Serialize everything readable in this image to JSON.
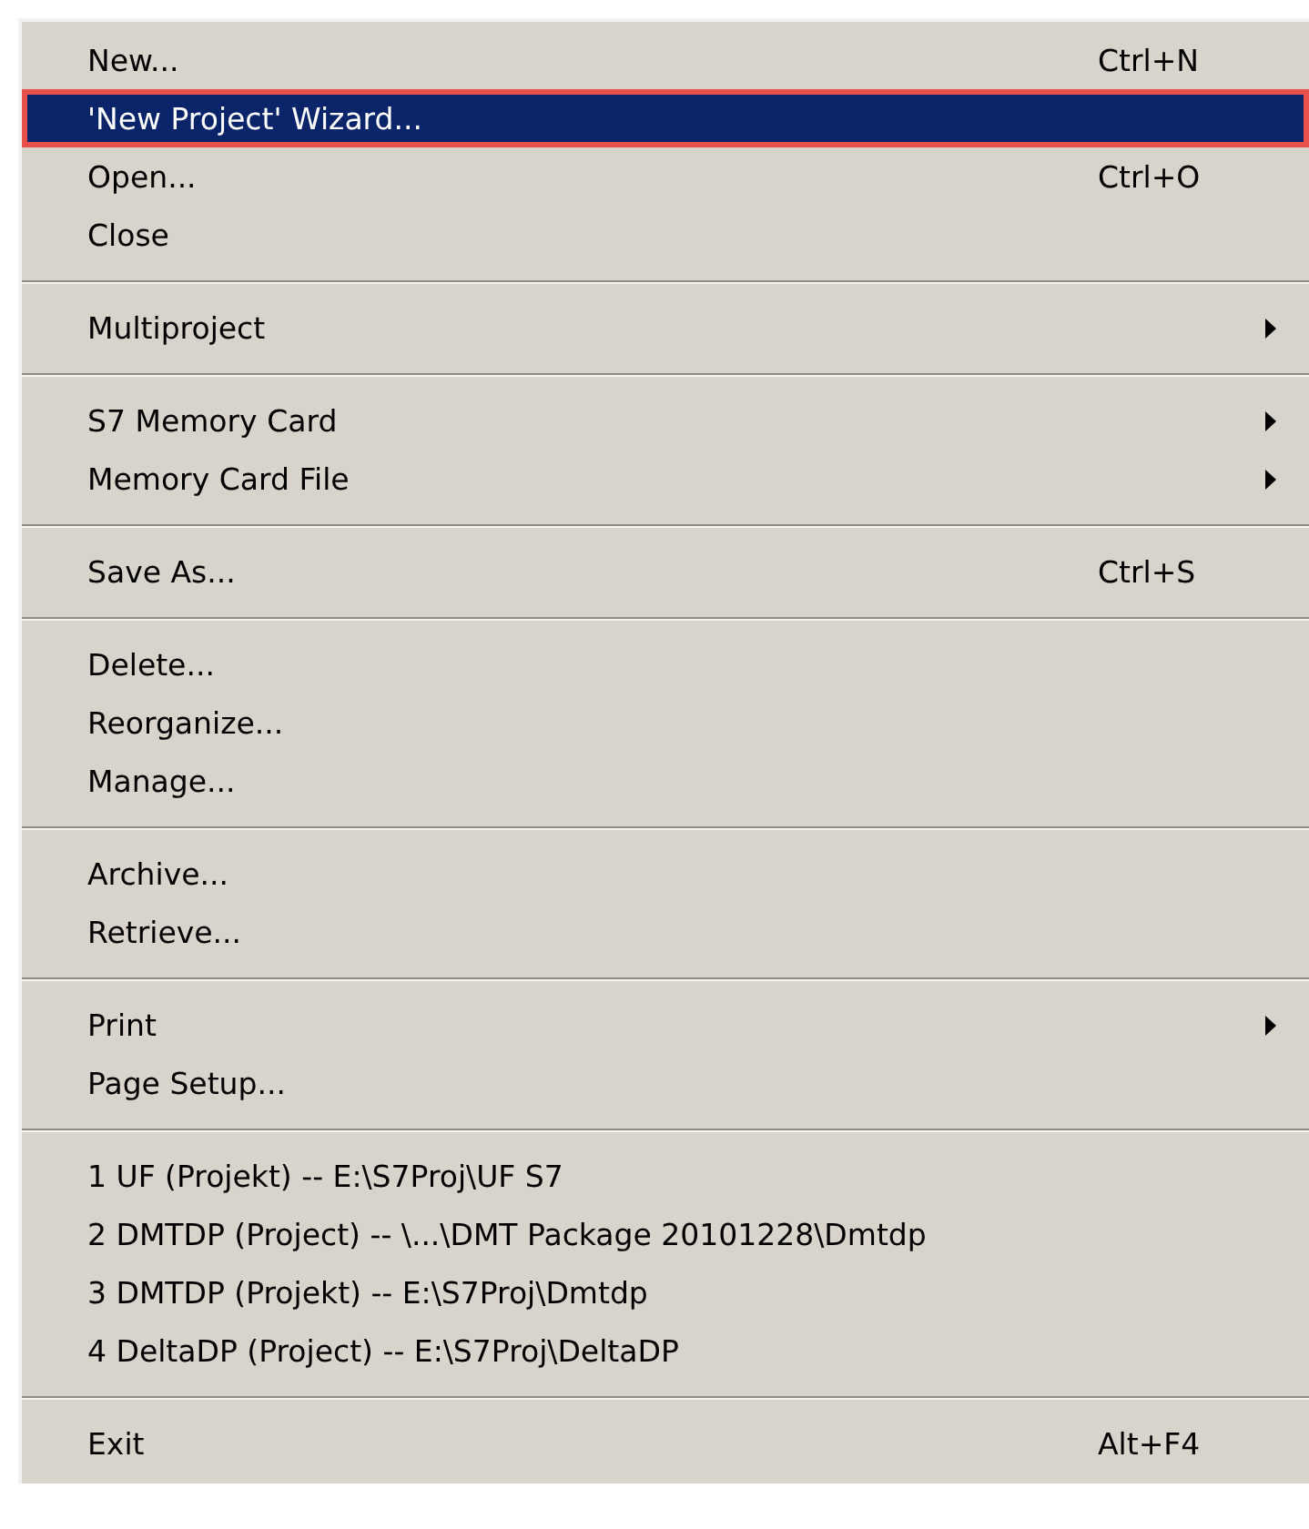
{
  "menu": {
    "groups": [
      {
        "items": [
          {
            "label": "New...",
            "shortcut": "Ctrl+N",
            "submenu": false,
            "selected": false
          },
          {
            "label": "'New Project' Wizard...",
            "submenu": false,
            "selected": true
          },
          {
            "label": "Open...",
            "shortcut": "Ctrl+O",
            "submenu": false,
            "selected": false
          },
          {
            "label": "Close",
            "submenu": false,
            "selected": false
          }
        ]
      },
      {
        "items": [
          {
            "label": "Multiproject",
            "submenu": true,
            "selected": false
          }
        ]
      },
      {
        "items": [
          {
            "label": "S7 Memory Card",
            "submenu": true,
            "selected": false
          },
          {
            "label": "Memory Card File",
            "submenu": true,
            "selected": false
          }
        ]
      },
      {
        "items": [
          {
            "label": "Save As...",
            "shortcut": "Ctrl+S",
            "submenu": false,
            "selected": false
          }
        ]
      },
      {
        "items": [
          {
            "label": "Delete...",
            "submenu": false,
            "selected": false
          },
          {
            "label": "Reorganize...",
            "submenu": false,
            "selected": false
          },
          {
            "label": "Manage...",
            "submenu": false,
            "selected": false
          }
        ]
      },
      {
        "items": [
          {
            "label": "Archive...",
            "submenu": false,
            "selected": false
          },
          {
            "label": "Retrieve...",
            "submenu": false,
            "selected": false
          }
        ]
      },
      {
        "items": [
          {
            "label": "Print",
            "submenu": true,
            "selected": false
          },
          {
            "label": "Page Setup...",
            "submenu": false,
            "selected": false
          }
        ]
      },
      {
        "items": [
          {
            "label": "1 UF (Projekt) -- E:\\S7Proj\\UF S7",
            "submenu": false,
            "selected": false
          },
          {
            "label": "2 DMTDP (Project) -- \\...\\DMT Package 20101228\\Dmtdp",
            "submenu": false,
            "selected": false
          },
          {
            "label": "3 DMTDP (Projekt) -- E:\\S7Proj\\Dmtdp",
            "submenu": false,
            "selected": false
          },
          {
            "label": "4 DeltaDP (Project) -- E:\\S7Proj\\DeltaDP",
            "submenu": false,
            "selected": false
          }
        ]
      },
      {
        "items": [
          {
            "label": "Exit",
            "shortcut": "Alt+F4",
            "submenu": false,
            "selected": false
          }
        ]
      }
    ]
  }
}
